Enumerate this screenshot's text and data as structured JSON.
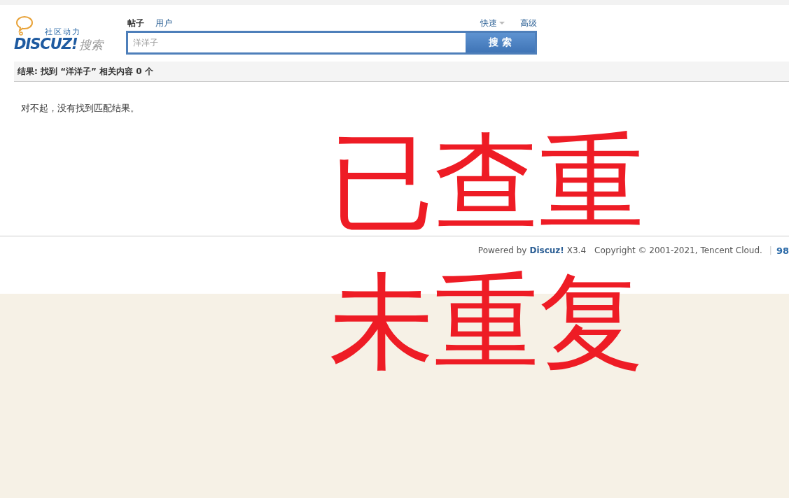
{
  "logo": {
    "tagline": "社区动力",
    "brand": "DISCUZ!",
    "suffix": "搜索"
  },
  "search": {
    "tabs": [
      {
        "label": "帖子",
        "selected": true
      },
      {
        "label": "用户",
        "selected": false
      }
    ],
    "links": [
      {
        "label": "快速",
        "kind": "dropdown"
      },
      {
        "label": "高级",
        "kind": "link"
      }
    ],
    "value": "洋洋子",
    "button": "搜 索"
  },
  "result_bar": "结果: 找到 “洋洋子” 相关内容 0 个",
  "message": "对不起，没有找到匹配结果。",
  "annotation": [
    "已查重",
    "未重复"
  ],
  "footer": {
    "powered_by": "Powered by",
    "brand": "Discuz!",
    "version": "X3.4",
    "copyright": "Copyright © 2001-2021, Tencent Cloud.",
    "separator": "|",
    "link": "98"
  }
}
